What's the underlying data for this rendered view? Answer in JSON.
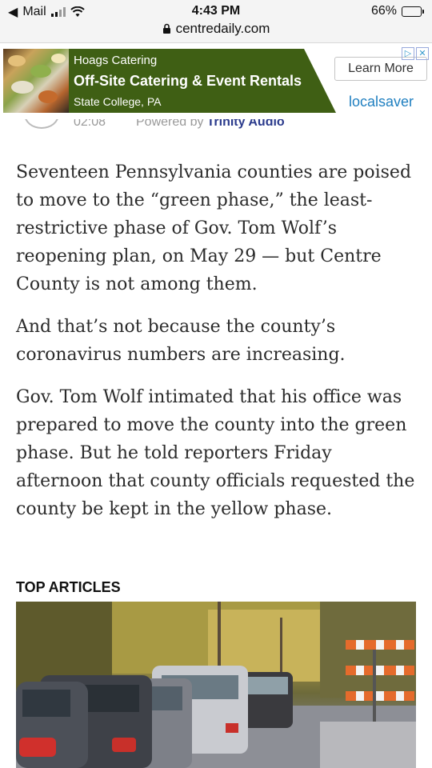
{
  "status_bar": {
    "back_app": "Mail",
    "time": "4:43 PM",
    "battery": "66%",
    "battery_level": 0.66,
    "url": "centredaily.com"
  },
  "ad": {
    "brand": "Hoags Catering",
    "title": "Off-Site Catering & Event Rentals",
    "location": "State College, PA",
    "cta": "Learn More",
    "network_logo": "localsaver",
    "banner_color": "#3f5f14"
  },
  "audio_player": {
    "time": "02:08",
    "powered_by": "Powered by",
    "provider": "Trinity Audio"
  },
  "article": {
    "paragraphs": [
      "Seventeen Pennsylvania counties are poised to move to the “green phase,” the least-restrictive phase of Gov. Tom Wolf’s reopening plan, on May 29 — but Centre County is not among them.",
      "And that’s not because the county’s coronavirus numbers are increasing.",
      "Gov. Tom Wolf intimated that his office was prepared to move the county into the green phase. But he told reporters Friday afternoon that county officials requested the county be kept in the yellow phase."
    ]
  },
  "top_articles": {
    "heading": "TOP ARTICLES"
  }
}
